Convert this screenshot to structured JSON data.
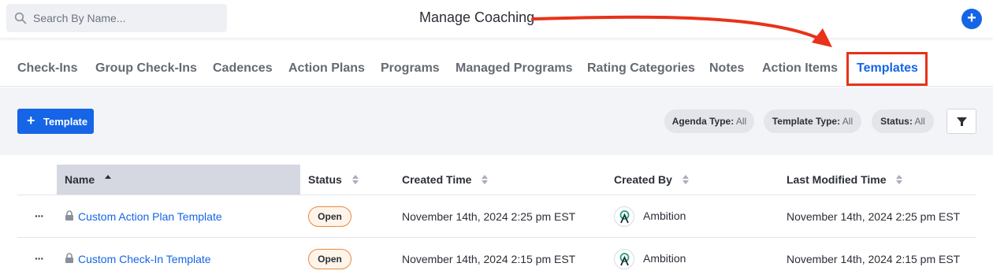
{
  "search": {
    "placeholder": "Search By Name..."
  },
  "header": {
    "title": "Manage Coaching",
    "add_label": "+"
  },
  "tabs": [
    {
      "label": "Check-Ins"
    },
    {
      "label": "Group Check-Ins"
    },
    {
      "label": "Cadences"
    },
    {
      "label": "Action Plans"
    },
    {
      "label": "Programs"
    },
    {
      "label": "Managed Programs"
    },
    {
      "label": "Rating Categories"
    },
    {
      "label": "Notes"
    },
    {
      "label": "Action Items"
    },
    {
      "label": "Templates",
      "active": true
    }
  ],
  "toolbar": {
    "add_template_label": "Template",
    "filters": [
      {
        "label": "Agenda Type:",
        "value": "All"
      },
      {
        "label": "Template Type:",
        "value": "All"
      },
      {
        "label": "Status:",
        "value": "All"
      }
    ]
  },
  "table": {
    "columns": [
      "Name",
      "Status",
      "Created Time",
      "Created By",
      "Last Modified Time"
    ],
    "sorted_column": "Name",
    "rows": [
      {
        "actions": "···",
        "name": "Custom Action Plan Template",
        "status": "Open",
        "created_time": "November 14th, 2024 2:25 pm EST",
        "created_by": "Ambition",
        "last_modified": "November 14th, 2024 2:25 pm EST"
      },
      {
        "actions": "···",
        "name": "Custom Check-In Template",
        "status": "Open",
        "created_time": "November 14th, 2024 2:15 pm EST",
        "created_by": "Ambition",
        "last_modified": "November 14th, 2024 2:15 pm EST"
      }
    ]
  },
  "colors": {
    "accent": "#1565e6",
    "annotation": "#e8321a",
    "badge_border": "#e8893f"
  }
}
